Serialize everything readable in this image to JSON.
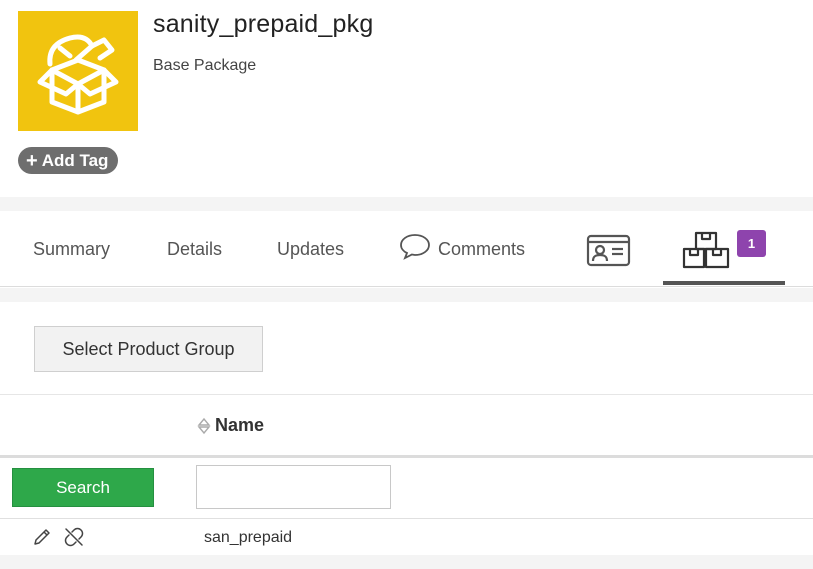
{
  "package": {
    "name": "sanity_prepaid_pkg",
    "type": "Base Package",
    "icon": "open-box-icon",
    "icon_bg": "#f1c40f"
  },
  "add_tag": {
    "label": "Add Tag",
    "icon": "plus-icon"
  },
  "tabs": [
    {
      "label": "Summary"
    },
    {
      "label": "Details"
    },
    {
      "label": "Updates"
    },
    {
      "label": "Comments",
      "icon": "speech-bubble-icon"
    },
    {
      "label": "",
      "icon": "contact-card-icon"
    },
    {
      "label": "",
      "icon": "boxes-icon",
      "badge": "1",
      "active": true
    }
  ],
  "toolbar": {
    "select_product_group": "Select Product Group"
  },
  "table": {
    "columns": [
      {
        "label": "Name",
        "sortable": true
      }
    ],
    "search_button": "Search",
    "search_value": "",
    "rows": [
      {
        "name": "san_prepaid"
      }
    ]
  },
  "colors": {
    "accent_yellow": "#f1c40f",
    "badge_purple": "#8e44ad",
    "search_green": "#2ea84a",
    "tag_gray": "#6e6e6e"
  }
}
